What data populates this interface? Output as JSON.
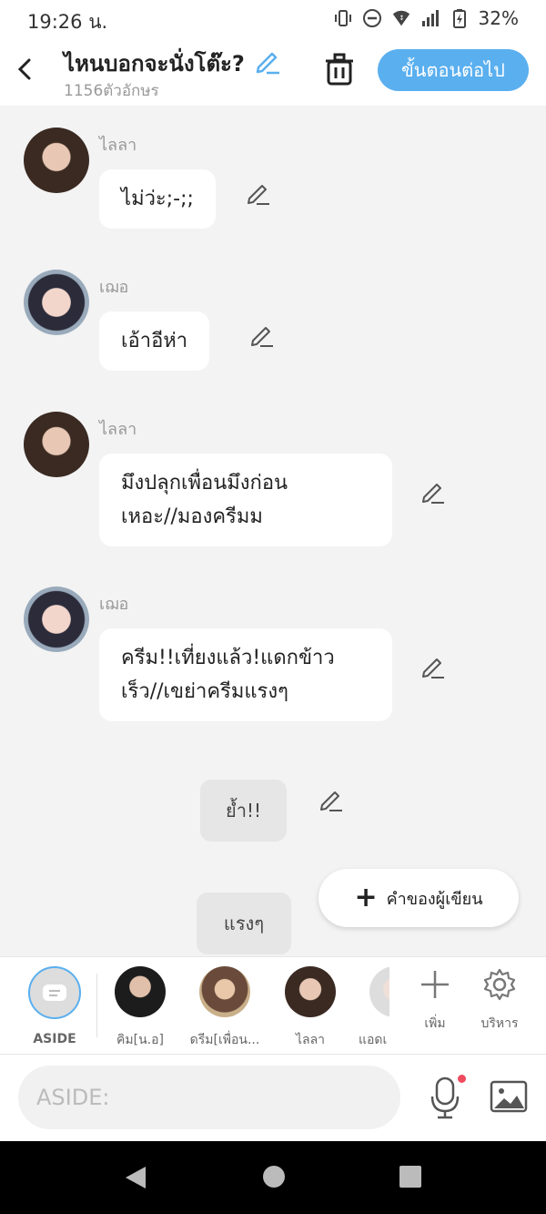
{
  "status": {
    "time": "19:26 น.",
    "battery": "32%"
  },
  "header": {
    "title": "ไหนบอกจะนั่งโต๊ะ?",
    "char_count": "1156ตัวอักษร",
    "next_label": "ขั้นตอนต่อไป"
  },
  "messages": [
    {
      "speaker": "ไลลา",
      "text": "ไม่ว่ะ;-;;"
    },
    {
      "speaker": "เฌอ",
      "text": "เอ้าอีห่า"
    },
    {
      "speaker": "ไลลา",
      "line1": "มึงปลุกเพื่อนมึงก่อน",
      "line2": "เหอะ//มองครีมม"
    },
    {
      "speaker": "เฌอ",
      "line1": "ครีม!!เที่ยงแล้ว!แดกข้าว",
      "line2": "เร็ว//เขย่าครีมแรงๆ"
    }
  ],
  "asides": [
    {
      "text": "ย้ำ!!"
    },
    {
      "text": "แรงๆ"
    }
  ],
  "fab": {
    "label": "คำของผู้เขียน"
  },
  "characters": [
    {
      "label": "ASIDE"
    },
    {
      "label": "คิม[น.อ]"
    },
    {
      "label": "ดรีม[เพื่อน..."
    },
    {
      "label": "ไลลา"
    },
    {
      "label": "แอดเ"
    }
  ],
  "tools": {
    "add_label": "เพิ่ม",
    "manage_label": "บริหาร"
  },
  "input": {
    "placeholder": "ASIDE:"
  },
  "colors": {
    "accent": "#5aafef",
    "notification_dot": "#ef4b5f"
  }
}
